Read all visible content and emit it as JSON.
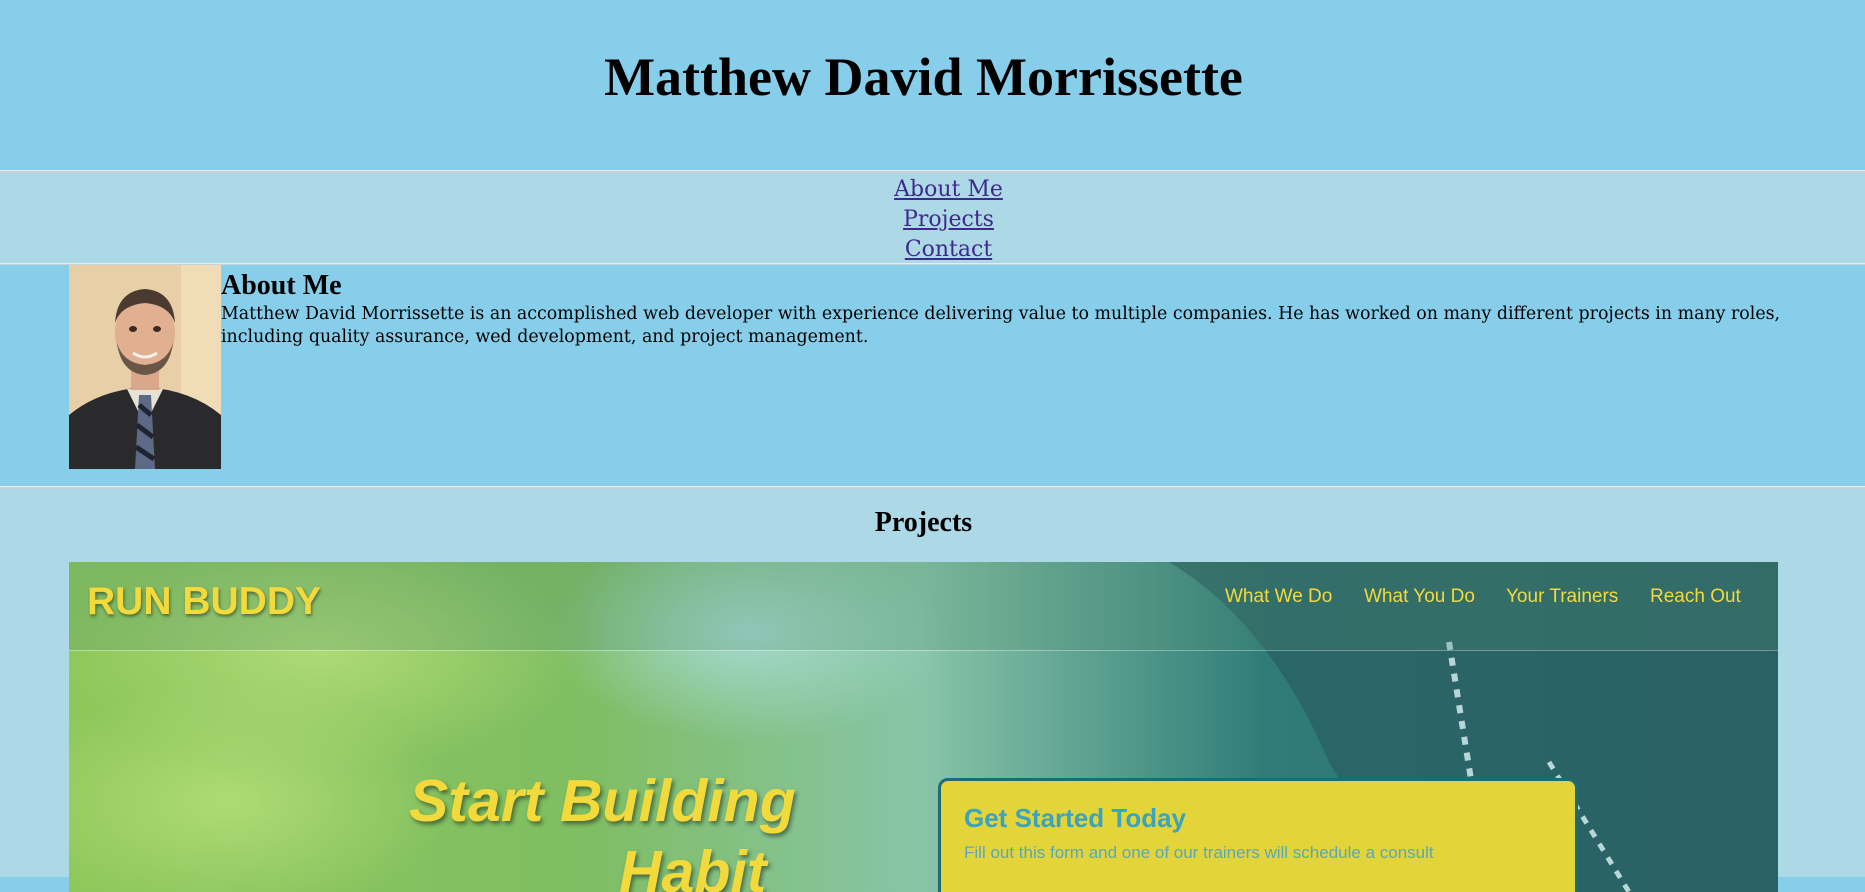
{
  "header": {
    "title": "Matthew David Morrissette"
  },
  "nav": {
    "items": [
      {
        "label": "About Me"
      },
      {
        "label": "Projects"
      },
      {
        "label": "Contact"
      }
    ]
  },
  "about": {
    "heading": "About Me",
    "body": "Matthew David Morrissette is an accomplished web developer with experience delivering value to multiple companies. He has worked on many different projects in many roles, including quality assurance, wed development, and project management."
  },
  "projects": {
    "heading": "Projects",
    "run_buddy": {
      "logo": "RUN BUDDY",
      "nav": [
        "What We Do",
        "What You Do",
        "Your Trainers",
        "Reach Out"
      ],
      "hero_line1": "Start Building",
      "hero_line2": "Habit",
      "card_title": "Get Started Today",
      "card_subtitle": "Fill out this form and one of our trainers will schedule a consult"
    }
  },
  "colors": {
    "page_bg": "#87CEEB",
    "nav_bg": "#ADD8E6",
    "link": "#3d2a8c",
    "accent_yellow": "#f2da3d"
  }
}
